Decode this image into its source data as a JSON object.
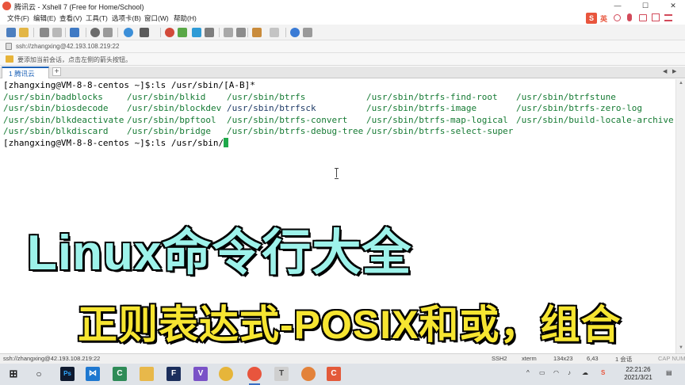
{
  "window": {
    "title": "腾讯云 - Xshell 7 (Free for Home/School)",
    "controls": {
      "minimize": "—",
      "maximize": "☐",
      "close": "✕"
    }
  },
  "menu": [
    "文件(F)",
    "编辑(E)",
    "查看(V)",
    "工具(T)",
    "选项卡(B)",
    "窗口(W)",
    "帮助(H)"
  ],
  "ime": {
    "label": "英"
  },
  "address": {
    "value": "ssh://zhangxing@42.193.108.219:22"
  },
  "hint": {
    "text": "要添加当前会话，点击左侧的箭头按钮。"
  },
  "tabs": [
    {
      "label": "1 腾讯云",
      "active": true
    }
  ],
  "tab_add": "+",
  "terminal": {
    "prompt_line_1": "[zhangxing@VM-8-8-centos ~]$:ls /usr/sbin/[A-B]*",
    "listing": [
      [
        "/usr/sbin/badblocks",
        "/usr/sbin/blkid",
        "/usr/sbin/btrfs",
        "/usr/sbin/btrfs-find-root",
        "/usr/sbin/btrfstune"
      ],
      [
        "/usr/sbin/biosdecode",
        "/usr/sbin/blockdev",
        "/usr/sbin/btrfsck",
        "/usr/sbin/btrfs-image",
        "/usr/sbin/btrfs-zero-log"
      ],
      [
        "/usr/sbin/blkdeactivate",
        "/usr/sbin/bpftool",
        "/usr/sbin/btrfs-convert",
        "/usr/sbin/btrfs-map-logical",
        "/usr/sbin/build-locale-archive"
      ],
      [
        "/usr/sbin/blkdiscard",
        "/usr/sbin/bridge",
        "/usr/sbin/btrfs-debug-tree",
        "/usr/sbin/btrfs-select-super",
        ""
      ]
    ],
    "prompt_line_2": "[zhangxing@VM-8-8-centos ~]$:ls /usr/sbin/"
  },
  "overlay": {
    "title": "Linux命令行大全",
    "subtitle": "正则表达式-POSIX和或，组合"
  },
  "status": {
    "connection": "ssh://zhangxing@42.193.108.219:22",
    "protocol": "SSH2",
    "terminal_type": "xterm",
    "size": "134x23",
    "cursor_pos": "6,43",
    "sessions": "1 会话",
    "caps": "CAP NUM"
  },
  "taskbar": {
    "time": "22:21:26",
    "date": "2021/3/21"
  },
  "colors": {
    "terminal_green": "#157a33",
    "cursor": "#1fa84a",
    "overlay_title": "#9df2ea",
    "overlay_subtitle": "#f6e531",
    "tab_accent": "#1e63b8"
  }
}
